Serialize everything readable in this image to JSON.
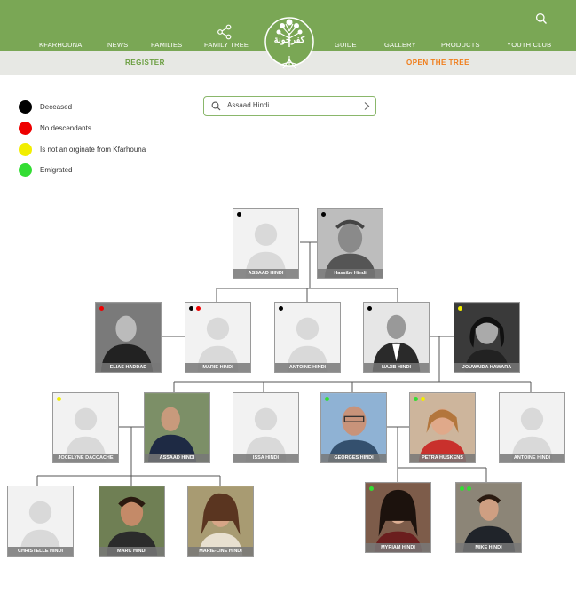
{
  "nav": {
    "items": [
      {
        "label": "KFARHOUNA"
      },
      {
        "label": "NEWS"
      },
      {
        "label": "FAMILIES"
      },
      {
        "label": "FAMILY TREE"
      },
      {
        "label": "GUIDE"
      },
      {
        "label": "GALLERY"
      },
      {
        "label": "PRODUCTS"
      },
      {
        "label": "YOUTH CLUB"
      }
    ],
    "logo_text": "كفرحونة"
  },
  "subnav": {
    "register": "REGISTER",
    "open_tree": "OPEN THE TREE"
  },
  "legend": [
    {
      "label": "Deceased",
      "color": "#000000"
    },
    {
      "label": "No descendants",
      "color": "#ee0000"
    },
    {
      "label": "Is not an orginate from Kfarhouna",
      "color": "#f2ee00"
    },
    {
      "label": "Emigrated",
      "color": "#33dd33"
    }
  ],
  "search": {
    "value": "Assaad Hindi"
  },
  "colors": {
    "topbar": "#7aa755",
    "register": "#6a9e3f",
    "open_tree": "#f07d1a"
  },
  "people": {
    "assaad_hindi_sr": {
      "name": "ASSAAD HINDI",
      "status": [
        "deceased"
      ]
    },
    "hassibe_hindi": {
      "name": "Hassibe Hindi",
      "status": [
        "deceased"
      ]
    },
    "elias_haddad": {
      "name": "ELIAS HADDAD",
      "status": [
        "no-descendants"
      ]
    },
    "marie_hindi": {
      "name": "MARIE HINDI",
      "status": [
        "deceased",
        "no-descendants"
      ]
    },
    "antoine_hindi_sr": {
      "name": "ANTOINE HINDI",
      "status": [
        "deceased"
      ]
    },
    "najib_hindi": {
      "name": "NAJIB HINDI",
      "status": [
        "deceased"
      ]
    },
    "jouwaida_hawara": {
      "name": "JOUWAIDA HAWARA",
      "status": [
        "not-originate"
      ]
    },
    "jocelyne_daccache": {
      "name": "JOCELYNE DACCACHE",
      "status": [
        "not-originate"
      ]
    },
    "assaad_hindi_jr": {
      "name": "ASSAAD HINDI",
      "status": []
    },
    "issa_hindi": {
      "name": "ISSA HINDI",
      "status": []
    },
    "georges_hindi": {
      "name": "GEORGES HINDI",
      "status": [
        "emigrated"
      ]
    },
    "petra_huskens": {
      "name": "PETRA HUSKENS",
      "status": [
        "emigrated",
        "not-originate"
      ]
    },
    "antoine_hindi_jr": {
      "name": "ANTOINE HINDI",
      "status": []
    },
    "christelle_hindi": {
      "name": "CHRISTELLE HINDI",
      "status": []
    },
    "marc_hindi": {
      "name": "MARC HINDI",
      "status": []
    },
    "marie_line_hindi": {
      "name": "MARIE-LINE HINDI",
      "status": []
    },
    "myriam_hindi": {
      "name": "MYRIAM HINDI",
      "status": [
        "emigrated"
      ]
    },
    "mike_hindi": {
      "name": "MIKE HINDI",
      "status": [
        "emigrated",
        "emigrated"
      ]
    }
  }
}
